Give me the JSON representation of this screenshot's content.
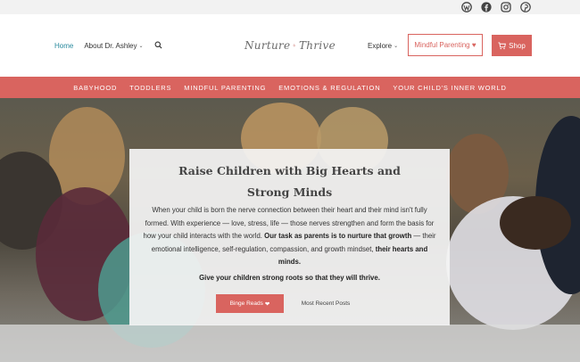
{
  "social": {
    "icons": [
      "wordpress-icon",
      "facebook-icon",
      "instagram-icon",
      "pinterest-icon"
    ]
  },
  "header": {
    "nav_left": {
      "home": "Home",
      "about": "About Dr. Ashley",
      "about_chevron": "⌄"
    },
    "logo": {
      "word1": "Nurture",
      "word2": "Thrive"
    },
    "nav_right": {
      "explore": "Explore",
      "explore_chevron": "⌄",
      "mindful_button": "Mindful Parenting ♥",
      "shop_button": "Shop"
    }
  },
  "category_nav": {
    "items": [
      "BABYHOOD",
      "TODDLERS",
      "MINDFUL PARENTING",
      "EMOTIONS & REGULATION",
      "YOUR CHILD'S INNER WORLD"
    ]
  },
  "hero": {
    "title_line1": "Raise Children with Big Hearts and",
    "title_line2": "Strong Minds",
    "body_part1": "When your child is born the nerve connection between their heart and their mind isn't fully formed. With experience — love, stress, life — those nerves strengthen and form the basis for how your child interacts with the world. ",
    "body_bold1": "Our task as parents is to nurture that growth",
    "body_part2": " — their emotional intelligence, self-regulation, compassion, and growth mindset, ",
    "body_bold2": "their hearts and minds.",
    "roots": "Give your children strong roots so that they will thrive.",
    "binge_button": "Binge Reads",
    "binge_heart": "❤",
    "recent_link": "Most Recent Posts"
  },
  "colors": {
    "accent": "#d9645f",
    "home_link": "#2a8a9e",
    "social_bar_bg": "#f2f2f2"
  }
}
